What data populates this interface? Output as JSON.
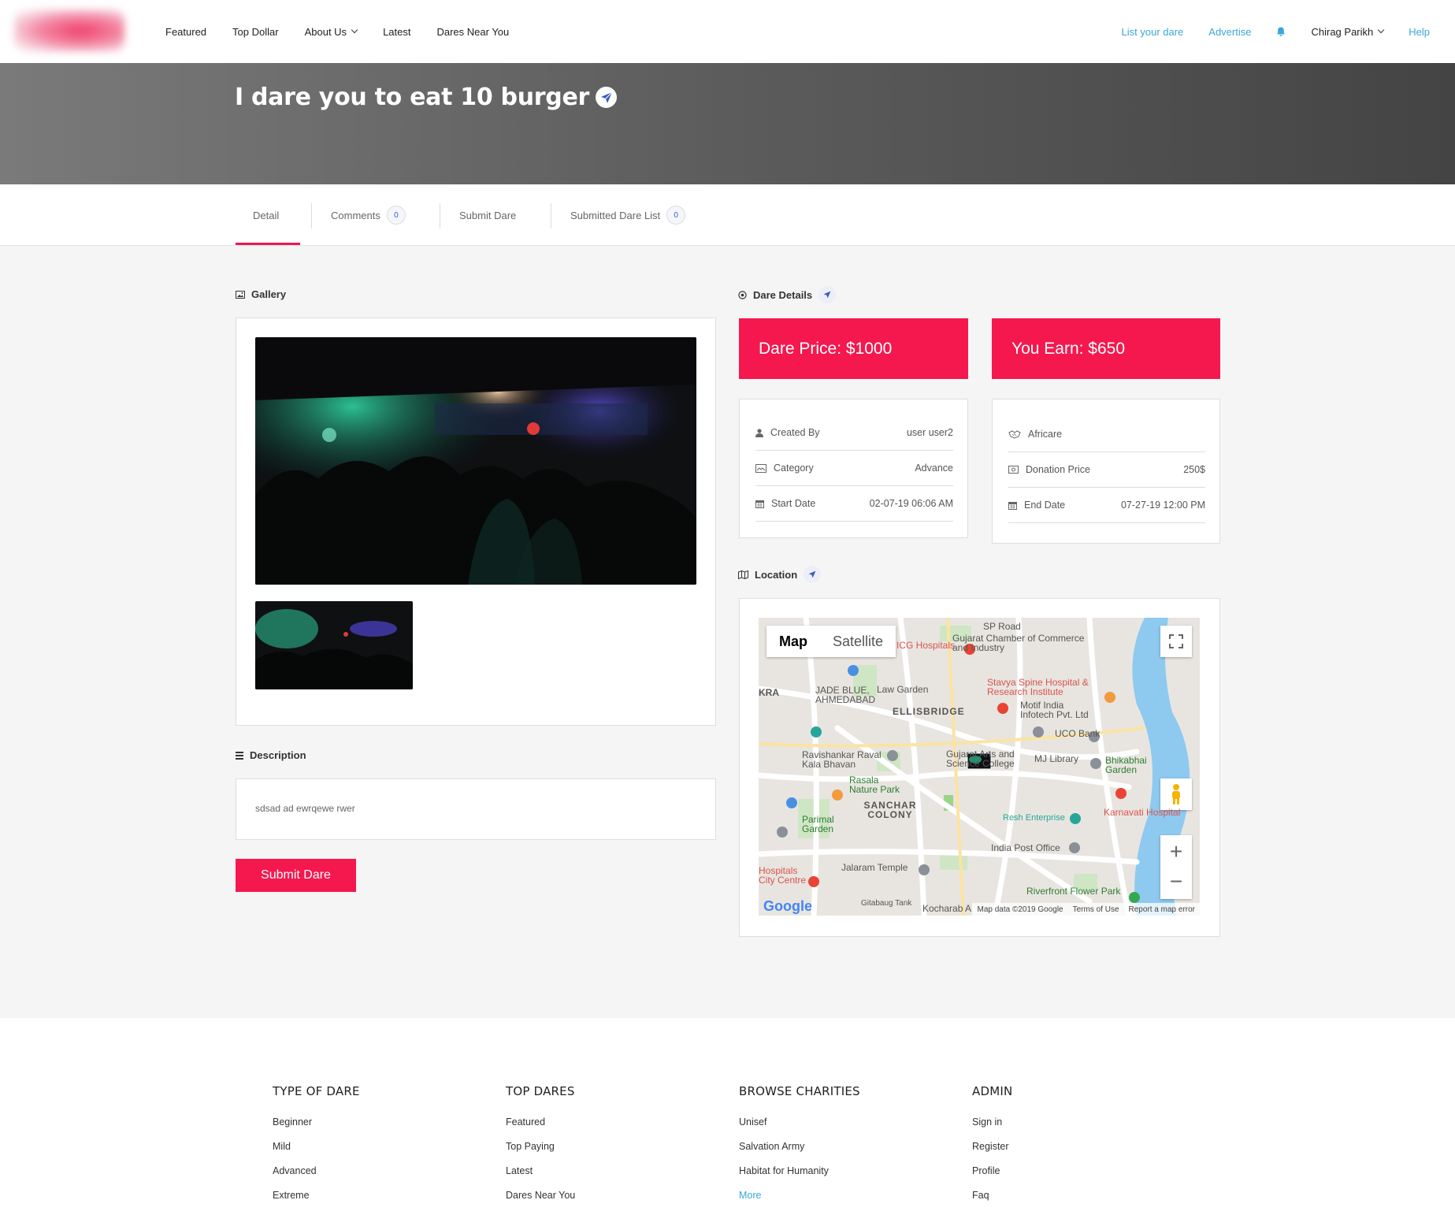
{
  "nav": {
    "left": [
      {
        "label": "Featured"
      },
      {
        "label": "Top Dollar"
      },
      {
        "label": "About Us"
      },
      {
        "label": "Latest"
      },
      {
        "label": "Dares Near You"
      }
    ],
    "right": {
      "list_dare": "List your dare",
      "advertise": "Advertise",
      "user": "Chirag Parikh",
      "help": "Help"
    }
  },
  "hero": {
    "title": "I dare you to eat 10 burger"
  },
  "tabs": [
    {
      "label": "Detail"
    },
    {
      "label": "Comments",
      "count": "0"
    },
    {
      "label": "Submit Dare"
    },
    {
      "label": "Submitted Dare List",
      "count": "0"
    }
  ],
  "gallery": {
    "heading": "Gallery"
  },
  "dare_details": {
    "heading": "Dare Details",
    "price": "Dare Price: $1000",
    "earn": "You Earn: $650",
    "left": [
      {
        "label": "Created By",
        "value": "user user2"
      },
      {
        "label": "Category",
        "value": "Advance"
      },
      {
        "label": "Start Date",
        "value": "02-07-19 06:06 AM"
      }
    ],
    "right": {
      "charity": "Africare",
      "rows": [
        {
          "label": "Donation Price",
          "value": "250$"
        },
        {
          "label": "End Date",
          "value": "07-27-19 12:00 PM"
        }
      ]
    }
  },
  "location": {
    "heading": "Location",
    "map_tab": "Map",
    "satellite_tab": "Satellite",
    "labels": {
      "gujarat_chamber": "Gujarat Chamber of Commerce and Industry",
      "icg": "ICG Hospitals",
      "stavya": "Stavya Spine Hospital & Research Institute",
      "motif": "Motif India Infotech Pvt. Ltd",
      "ellisbridge": "ELLISBRIDGE",
      "jade": "JADE BLUE, AHMEDABAD",
      "law_garden": "Law Garden",
      "uco": "UCO Bank",
      "ravishankar": "Ravishankar Raval Kala Bhavan",
      "mj_library": "MJ Library",
      "bhikabhai": "Bhikabhai Garden",
      "rasala": "Rasala Nature Park",
      "sanchar": "SANCHAR COLONY",
      "parimal": "Parimal Garden",
      "resh": "Resh Enterprise",
      "karnavati": "Karnavati Hospital",
      "india_post": "India Post Office",
      "jalaram": "Jalaram Temple",
      "hospitals": "Hospitals City Centre",
      "riverfront": "Riverfront Flower Park",
      "kra": "KRA",
      "gujarat_arts": "Gujarat Arts and Science College",
      "sp_road": "SP Road",
      "gitabaug": "Gitabaug Tank",
      "google": "Google",
      "kocharab": "Kocharab A"
    },
    "footer": {
      "map_data": "Map data ©2019 Google",
      "terms": "Terms of Use",
      "report": "Report a map error"
    }
  },
  "description": {
    "heading": "Description",
    "text": "sdsad ad ewrqewe rwer"
  },
  "submit_button": "Submit Dare",
  "footer": {
    "columns": [
      {
        "title": "TYPE OF DARE",
        "links": [
          "Beginner",
          "Mild",
          "Advanced",
          "Extreme"
        ]
      },
      {
        "title": "TOP DARES",
        "links": [
          "Featured",
          "Top Paying",
          "Latest",
          "Dares Near You"
        ]
      },
      {
        "title": "BROWSE CHARITIES",
        "links": [
          "Unisef",
          "Salvation Army",
          "Habitat for Humanity",
          "More"
        ]
      },
      {
        "title": "ADMIN",
        "links": [
          "Sign in",
          "Register",
          "Profile",
          "Faq"
        ]
      }
    ]
  },
  "colors": {
    "accent": "#f4184f",
    "link": "#3aa7d8",
    "hero_dark": "#444444"
  }
}
